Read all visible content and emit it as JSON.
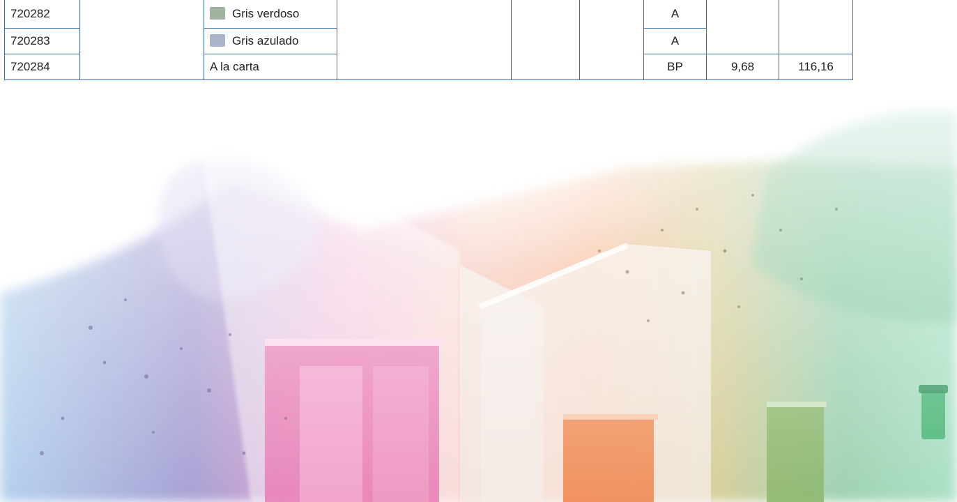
{
  "table": {
    "rows": [
      {
        "ref": "720282",
        "name": "Gris verdoso",
        "swatch_color": "#9fb3a0",
        "code": "A",
        "price_a": "",
        "price_b": ""
      },
      {
        "ref": "720283",
        "name": "Gris azulado",
        "swatch_color": "#aab6c8",
        "code": "A",
        "price_a": "",
        "price_b": ""
      },
      {
        "ref": "720284",
        "name": "A la carta",
        "swatch_color": "",
        "code": "BP",
        "price_a": "9,68",
        "price_b": "116,16"
      }
    ]
  },
  "colors": {
    "table_border": "#3f6ea6"
  },
  "hero_image": {
    "icon": "house-paint-splash-image"
  }
}
